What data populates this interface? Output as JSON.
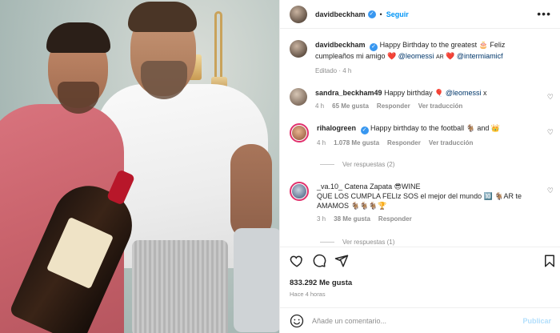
{
  "post": {
    "username": "davidbeckham",
    "follow_label": "Seguir",
    "more_label": "•••"
  },
  "caption": {
    "username": "davidbeckham",
    "text_1": "Happy Birthday to the greatest 🎂 Feliz",
    "text_2": "cumpleaños mi amigo ❤️",
    "mention_1": "@leomessi",
    "flag_1": "AR",
    "emoji_sep": "❤️",
    "mention_2": "@intermiamicf",
    "edited": "Editado · 4 h"
  },
  "comments": [
    {
      "username": "sandra_beckham49",
      "text": "Happy birthday 🎈",
      "mention": "@leomessi",
      "suffix": "x",
      "time": "4 h",
      "likes": "65 Me gusta",
      "reply": "Responder",
      "translate": "Ver traducción"
    },
    {
      "username": "rihalogreen",
      "text": "Happy birthday to the football 🐐 and 👑",
      "time": "4 h",
      "likes": "1.078 Me gusta",
      "reply": "Responder",
      "translate": "Ver traducción",
      "replies": "Ver respuestas (2)"
    },
    {
      "username": "_va.10_",
      "line1_rest": "Catena Zapata 😎WINE",
      "line2": "QUE LOS CUMPLA FELIz SOS el mejor del mundo 🔟 🐐AR te",
      "line3": "AMAMOS 🐐🐐🐐🏆",
      "time": "3 h",
      "likes": "38 Me gusta",
      "reply": "Responder",
      "replies": "Ver respuestas (1)"
    }
  ],
  "footer": {
    "likes": "833.292 Me gusta",
    "time": "Hace 4 horas",
    "comment_placeholder": "Añade un comentario...",
    "publish_label": "Publicar"
  },
  "icons": [
    "heart-icon",
    "comment-icon",
    "share-icon",
    "bookmark-icon",
    "emoji-icon",
    "more-icon",
    "verified-icon"
  ],
  "colors": {
    "link": "#0095f6",
    "mention": "#00376b",
    "muted": "#8e8e8e",
    "verified": "#3897f0"
  }
}
